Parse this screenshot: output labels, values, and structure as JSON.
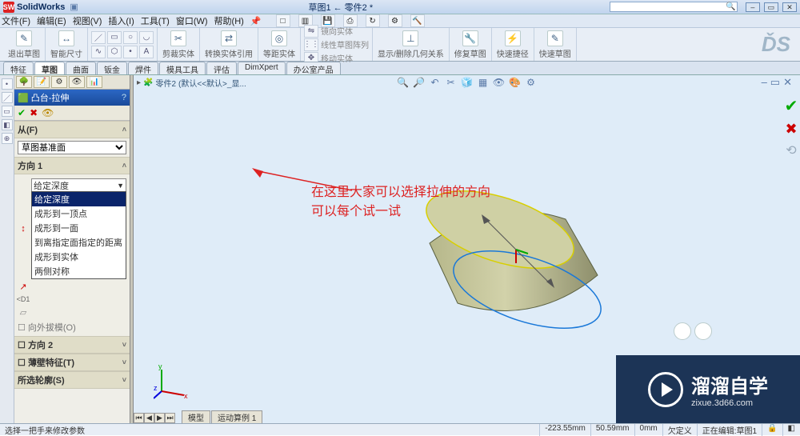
{
  "app": {
    "name": "SolidWorks",
    "doc_title": "草图1 ← 零件2 *"
  },
  "menu": [
    "文件(F)",
    "编辑(E)",
    "视图(V)",
    "插入(I)",
    "工具(T)",
    "窗口(W)",
    "帮助(H)"
  ],
  "search": {
    "placeholder": ""
  },
  "toolbar": {
    "exit_sketch": "退出草图",
    "smart_dim": "智能尺寸",
    "trim": "剪裁实体",
    "convert": "转换实体引用",
    "offset": "等距实体",
    "mirror": "镜向实体",
    "linear_pattern": "线性草图阵列",
    "move": "移动实体",
    "display": "显示/删除几何关系",
    "repair": "修复草图",
    "quick_snap": "快速捷径",
    "rapid_sketch": "快速草图"
  },
  "cmd_tabs": [
    "特征",
    "草图",
    "曲面",
    "钣金",
    "焊件",
    "模具工具",
    "评估",
    "DimXpert",
    "办公室产品"
  ],
  "breadcrumb": {
    "icon": "🧩",
    "part": "零件2",
    "config": "(默认<<默认>_显..."
  },
  "pm": {
    "title": "凸台-拉伸",
    "from_label": "从(F)",
    "from_value": "草图基准面",
    "dir1_label": "方向 1",
    "dir1_value": "给定深度",
    "options": [
      "给定深度",
      "成形到一顶点",
      "成形到一面",
      "到离指定面指定的距离",
      "成形到实体",
      "两侧对称"
    ],
    "draft_outward": "向外拔模(O)",
    "dir2_label": "方向 2",
    "thin_label": "薄壁特征(T)",
    "contours_label": "所选轮廓(S)"
  },
  "annotation": {
    "line1": "在这里大家可以选择拉伸的方向",
    "line2": "可以每个试一试"
  },
  "view_tabs": [
    "模型",
    "运动算例 1"
  ],
  "status": {
    "left": "选择一把手来修改参数",
    "coord": "-223.55mm",
    "val2": "50.59mm",
    "val3": "0mm",
    "underdef": "欠定义",
    "editing": "正在编辑:草图1"
  },
  "watermark": {
    "big": "溜溜自学",
    "small": "zixue.3d66.com"
  },
  "triad": {
    "x": "x",
    "y": "y",
    "z": "z"
  }
}
